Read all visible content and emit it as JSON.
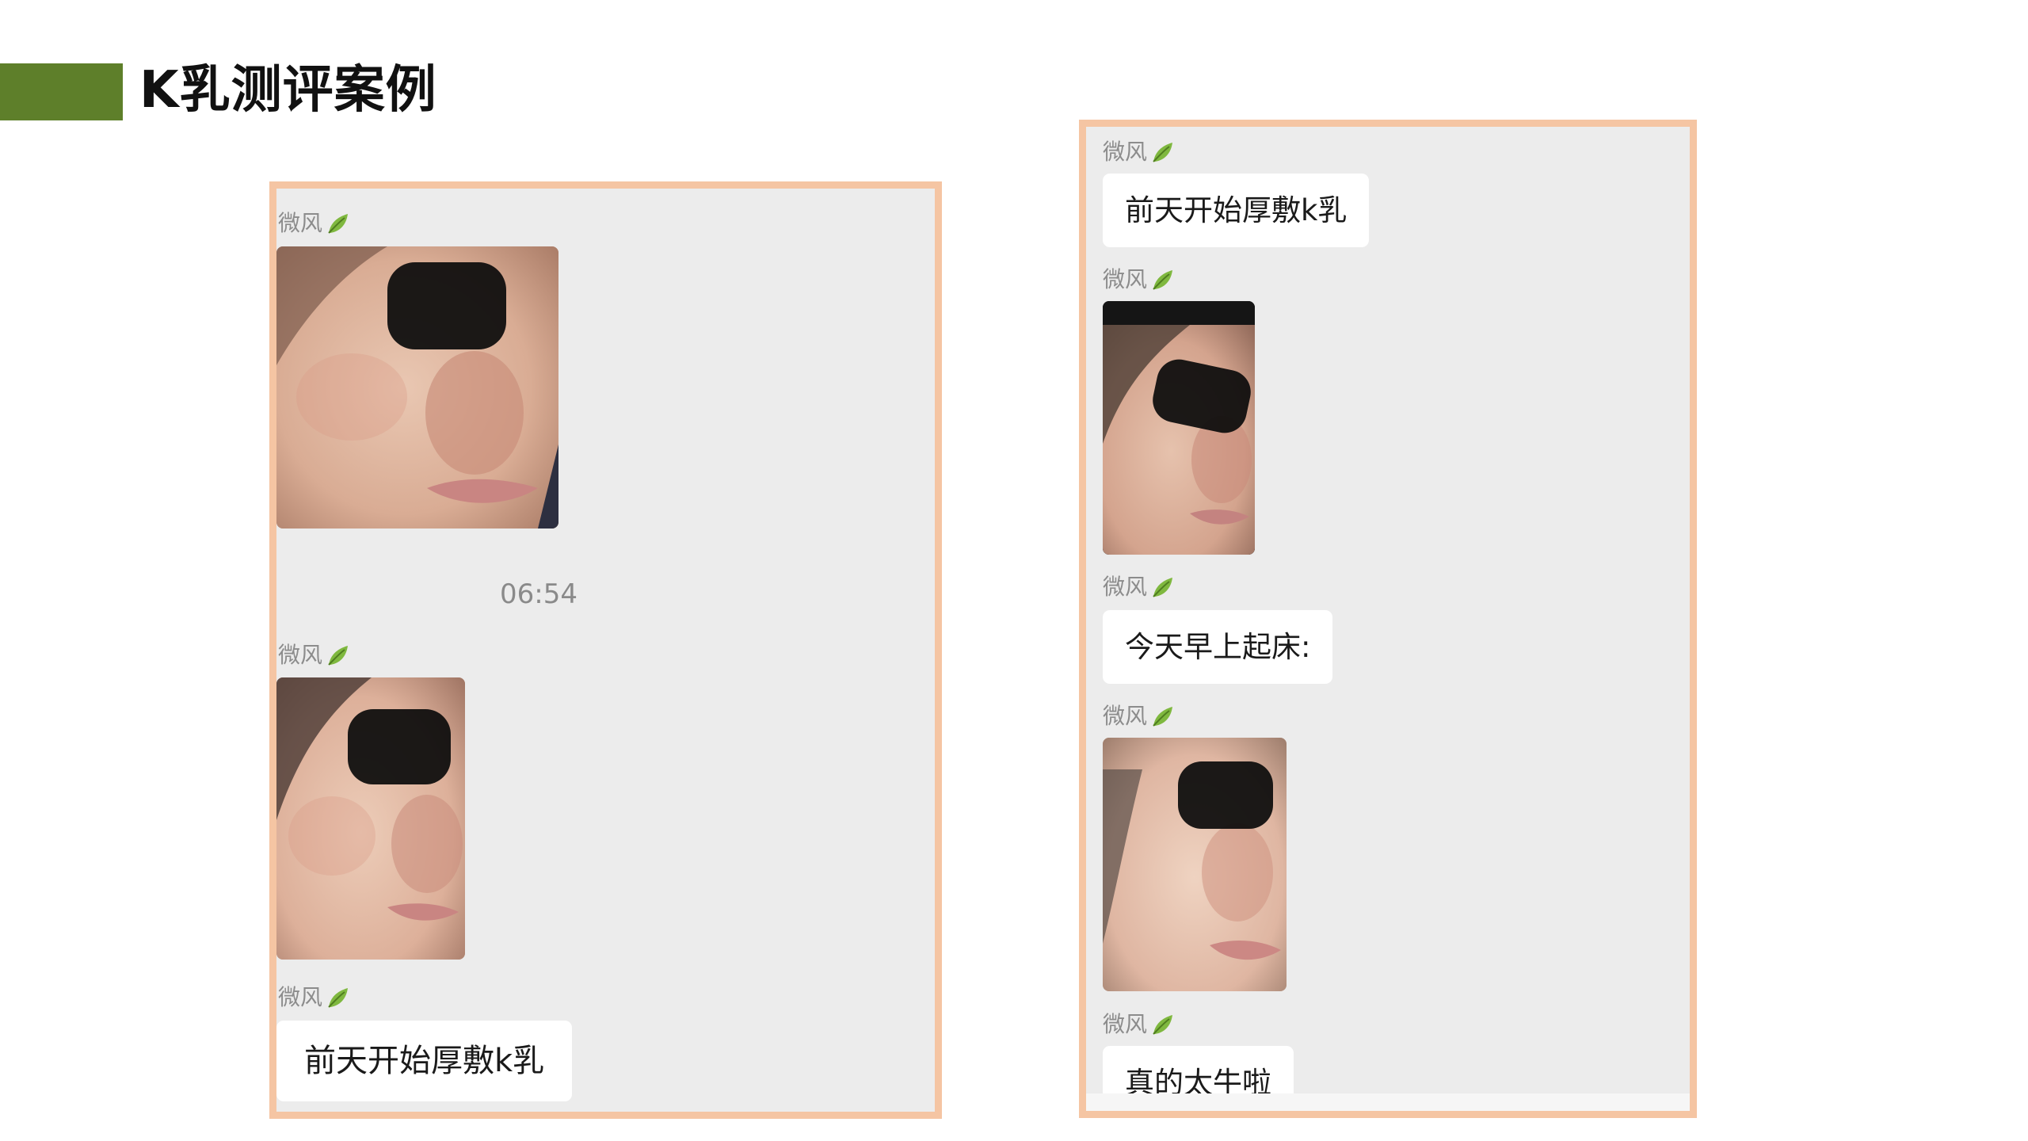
{
  "slide": {
    "title": "K乳测评案例",
    "accent_color": "#5e7f2a",
    "frame_color": "#f5c5a3",
    "chat_background": "#ececec"
  },
  "left_chat": {
    "messages": [
      {
        "sender": "微风",
        "sender_icon": "leaf-icon",
        "type": "image",
        "image": "face-photo-before"
      },
      {
        "type": "timestamp",
        "text": "06:54"
      },
      {
        "sender": "微风",
        "sender_icon": "leaf-icon",
        "type": "image",
        "image": "face-photo-after"
      },
      {
        "sender": "微风",
        "sender_icon": "leaf-icon",
        "type": "text",
        "text": "前天开始厚敷k乳"
      }
    ]
  },
  "right_chat": {
    "messages": [
      {
        "sender": "微风",
        "sender_icon": "leaf-icon",
        "type": "text",
        "text": "前天开始厚敷k乳"
      },
      {
        "sender": "微风",
        "sender_icon": "leaf-icon",
        "type": "image",
        "image": "face-photo-screenshot"
      },
      {
        "sender": "微风",
        "sender_icon": "leaf-icon",
        "type": "text",
        "text": "今天早上起床:"
      },
      {
        "sender": "微风",
        "sender_icon": "leaf-icon",
        "type": "image",
        "image": "face-photo-morning"
      },
      {
        "sender": "微风",
        "sender_icon": "leaf-icon",
        "type": "text",
        "text": "真的太牛啦"
      }
    ]
  }
}
